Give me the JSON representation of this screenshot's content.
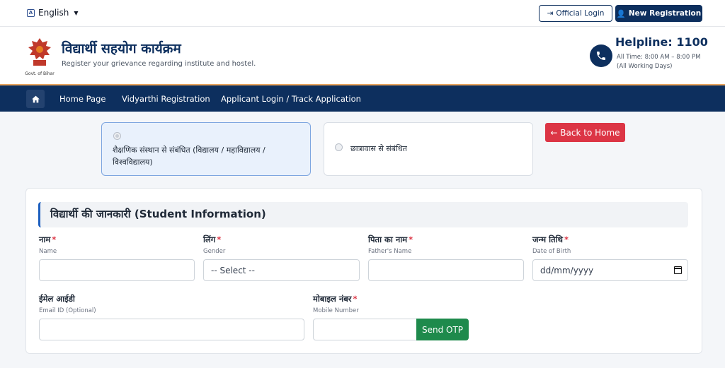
{
  "topbar": {
    "language": "English",
    "official_login": "Official Login",
    "new_registration": "New Registration"
  },
  "header": {
    "emblem_caption": "Govt. of Bihar",
    "title": "विद्यार्थी सहयोग कार्यक्रम",
    "subtitle": "Register your grievance regarding institute and hostel.",
    "helpline_title": "Helpline: 1100",
    "helpline_time": "All Time: 8:00 AM – 8:00 PM",
    "helpline_days": "(All Working Days)"
  },
  "nav": {
    "items": [
      "Home Page",
      "Vidyarthi Registration",
      "Applicant Login / Track Application"
    ]
  },
  "category": {
    "options": [
      {
        "line1": "शैक्षणिक संस्थान से संबंधित (विद्यालय / महाविद्यालय /",
        "line2": "विश्वविद्यालय)",
        "selected": true
      },
      {
        "line1": "छात्रावास से संबंधित",
        "line2": "",
        "selected": false
      }
    ],
    "back_button": "← Back to Home"
  },
  "form": {
    "section_title": "विद्यार्थी की जानकारी (Student Information)",
    "fields": {
      "name": {
        "label": "नाम",
        "sub": "Name",
        "value": ""
      },
      "gender": {
        "label": "लिंग",
        "sub": "Gender",
        "value": "-- Select --"
      },
      "father": {
        "label": "पिता का नाम",
        "sub": "Father's Name",
        "value": ""
      },
      "dob": {
        "label": "जन्म तिथि",
        "sub": "Date of Birth",
        "value": "dd/mm/yyyy"
      },
      "email": {
        "label": "ईमेल आईडी",
        "sub": "Email ID (Optional)",
        "value": ""
      },
      "mobile": {
        "label": "मोबाइल नंबर",
        "sub": "Mobile Number",
        "value": ""
      }
    },
    "required_mark": "*",
    "send_otp": "Send OTP"
  },
  "colors": {
    "primary": "#0d2f5e",
    "danger": "#dc3545",
    "success": "#1e8a4c",
    "accent_line": "#e8a45c"
  }
}
